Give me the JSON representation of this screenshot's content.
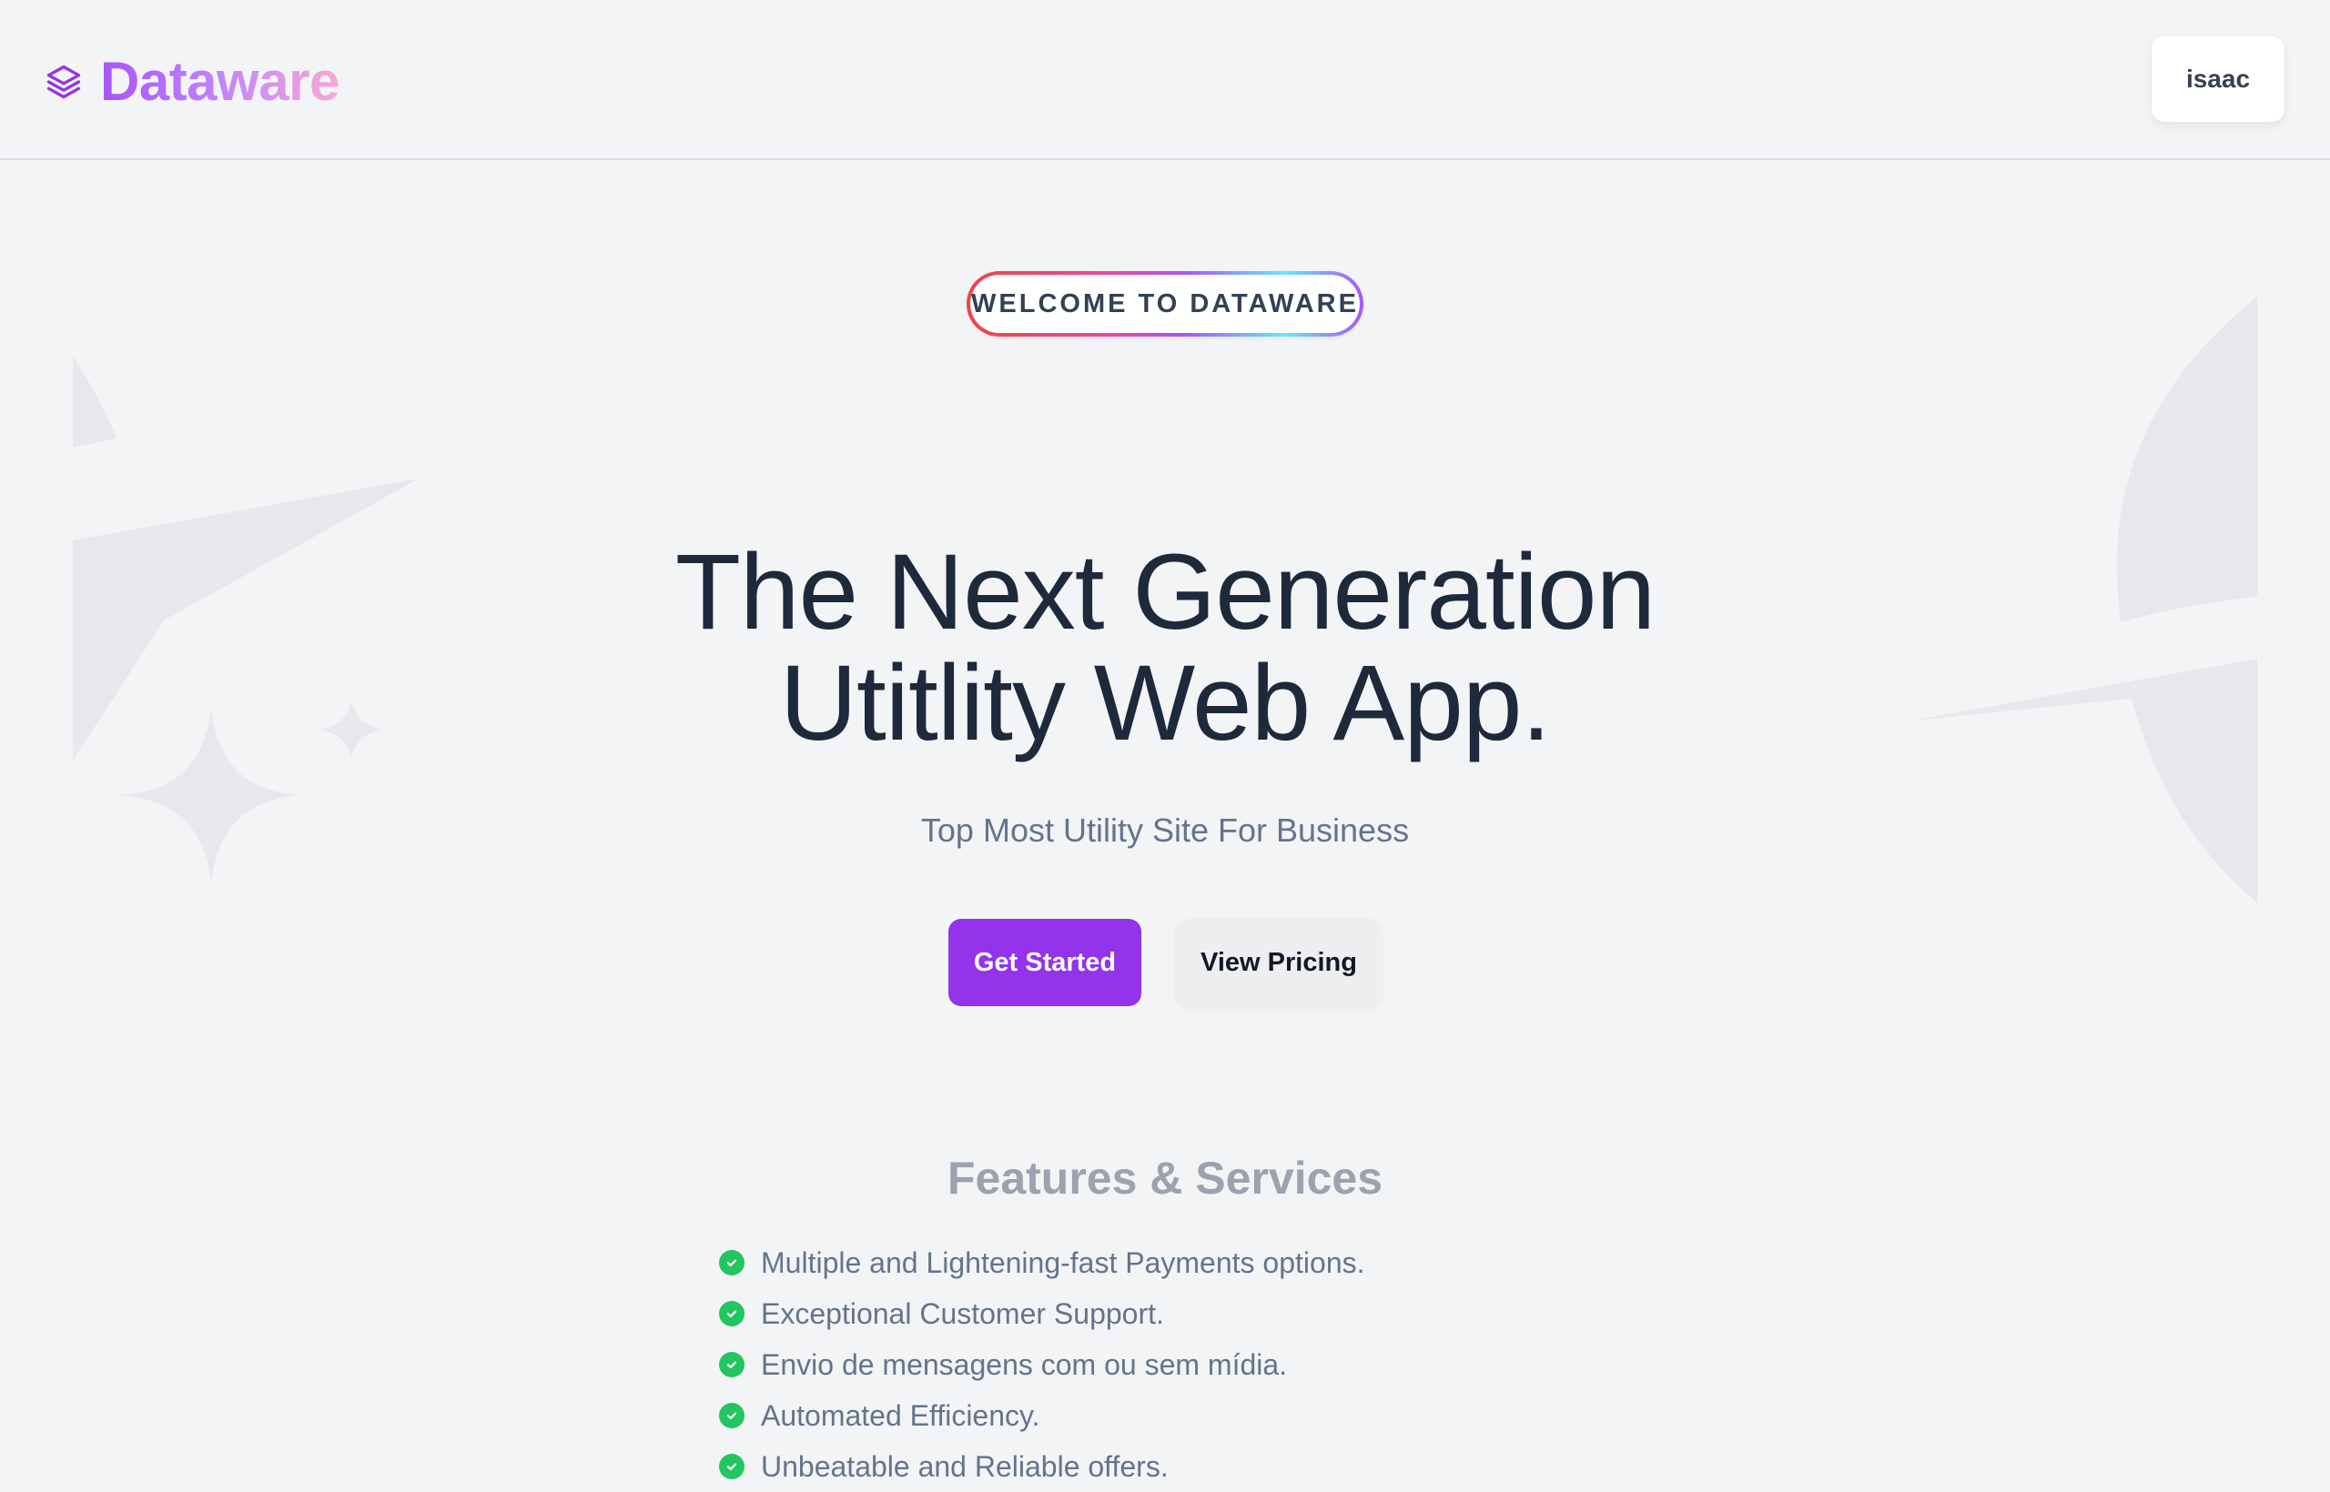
{
  "header": {
    "brand_name": "Dataware",
    "brand_icon": "layers-icon",
    "user_label": "isaac"
  },
  "hero": {
    "badge": "WELCOME TO DATAWARE",
    "headline_line1": "The Next Generation",
    "headline_line2": "Utitlity Web App.",
    "subtitle": "Top Most Utility Site For Business",
    "primary_cta": "Get Started",
    "secondary_cta": "View Pricing"
  },
  "features": {
    "title": "Features & Services",
    "check_icon": "check-circle-icon",
    "items": [
      "Multiple and Lightening-fast Payments options.",
      "Exceptional Customer Support.",
      "Envio de mensagens com ou sem mídia.",
      "Automated Efficiency.",
      "Unbeatable and Reliable offers."
    ]
  },
  "colors": {
    "background": "#f3f4f6",
    "brand_gradient_start": "#a855f7",
    "brand_gradient_end": "#f9a8d4",
    "primary_button": "#9333ea",
    "check": "#22c55e",
    "decoration": "#e5e7eb"
  }
}
